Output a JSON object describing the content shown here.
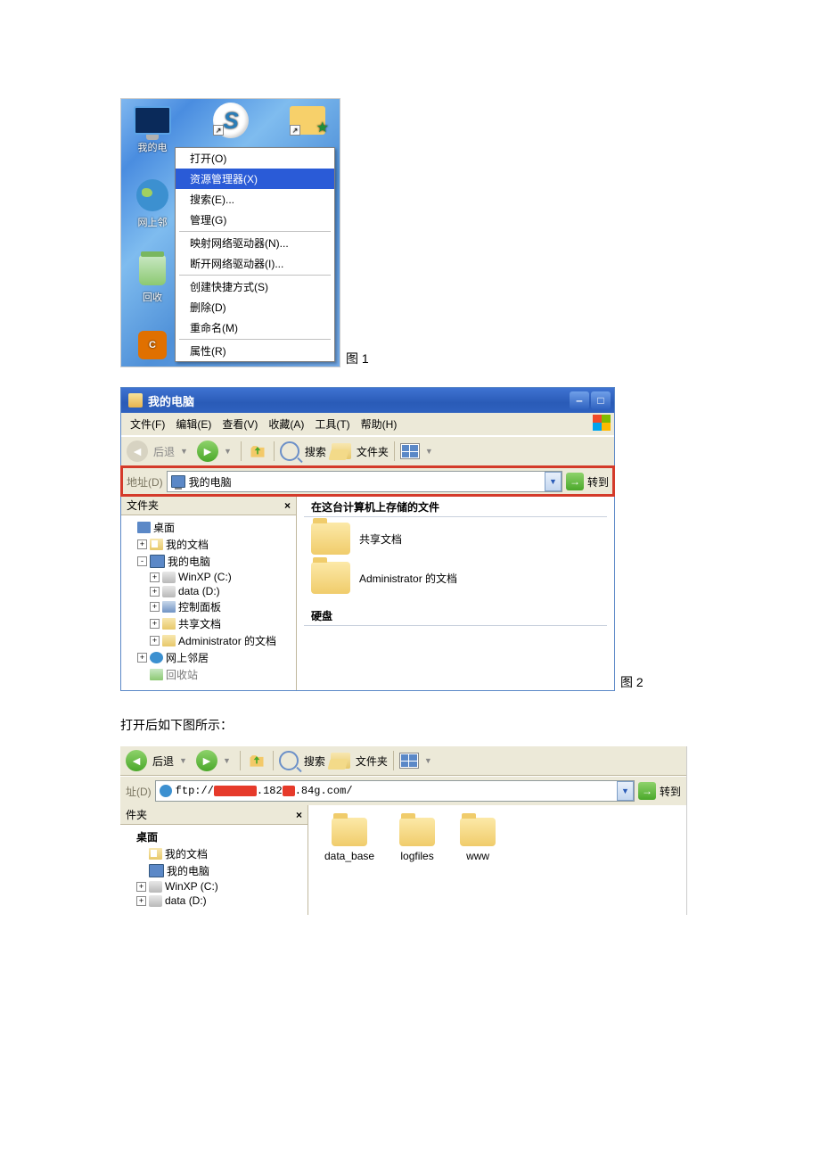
{
  "fig1": {
    "desktop_icons": {
      "mycomputer": "我的电",
      "neighbors": "网上邻",
      "recycle": "回收"
    },
    "context_menu": [
      "打开(O)",
      "资源管理器(X)",
      "搜索(E)...",
      "管理(G)",
      "映射网络驱动器(N)...",
      "断开网络驱动器(I)...",
      "创建快捷方式(S)",
      "删除(D)",
      "重命名(M)",
      "属性(R)"
    ],
    "selected_index": 1,
    "caption": "图 1"
  },
  "fig2": {
    "title": "我的电脑",
    "menus": [
      "文件(F)",
      "编辑(E)",
      "查看(V)",
      "收藏(A)",
      "工具(T)",
      "帮助(H)"
    ],
    "toolbar": {
      "back": "后退",
      "search": "搜索",
      "folders": "文件夹"
    },
    "address": {
      "label": "地址(D)",
      "value": "我的电脑",
      "go": "转到"
    },
    "tree_header": "文件夹",
    "tree": {
      "desktop": "桌面",
      "mydocs": "我的文档",
      "mycomputer": "我的电脑",
      "drive_c": "WinXP (C:)",
      "drive_d": "data (D:)",
      "controlpanel": "控制面板",
      "shared": "共享文档",
      "admin_docs": "Administrator 的文档",
      "netplaces": "网上邻居",
      "recyclebin": "回收站"
    },
    "content": {
      "section1": "在这台计算机上存储的文件",
      "shared_docs": "共享文档",
      "admin_docs": "Administrator 的文档",
      "section2": "硬盘"
    },
    "caption": "图 2"
  },
  "midtext": "打开后如下图所示：",
  "fig3": {
    "toolbar": {
      "back": "后退",
      "search": "搜索",
      "folders": "文件夹"
    },
    "address": {
      "label": "址(D)",
      "prefix": "ftp://",
      "mid": ".182",
      "suffix": ".84g.com/",
      "go": "转到"
    },
    "tree_header": "件夹",
    "tree": {
      "desktop": "桌面",
      "mydocs": "我的文档",
      "mycomputer": "我的电脑",
      "drive_c": "WinXP (C:)",
      "drive_d": "data (D:)"
    },
    "folders": [
      "data_base",
      "logfiles",
      "www"
    ]
  }
}
